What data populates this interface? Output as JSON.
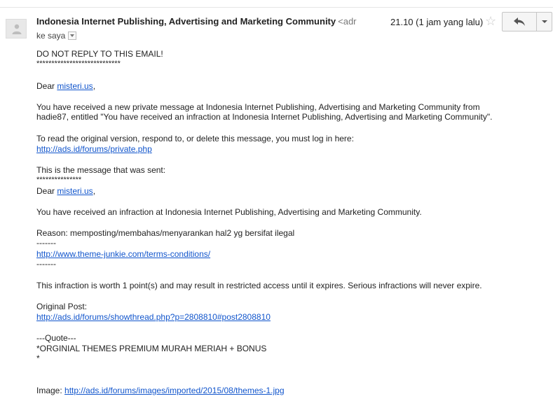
{
  "header": {
    "sender_name": "Indonesia Internet Publishing, Advertising and Marketing Community",
    "sender_email": "<adr",
    "recipient_label": "ke saya",
    "time": "21.10 (1 jam yang lalu)"
  },
  "icons": {
    "avatar": "person-icon",
    "star": "star-icon",
    "reply": "reply-arrow-icon",
    "more": "chevron-down-icon",
    "recipient_dropdown": "chevron-down-icon"
  },
  "colors": {
    "link": "#1155cc",
    "text": "#222222",
    "button_bg": "#f5f5f5"
  },
  "body": {
    "warning": "DO NOT REPLY TO THIS EMAIL!",
    "stars_long": "****************************",
    "dear1_prefix": "Dear ",
    "dear1_link": "misteri.us",
    "dear1_suffix": ",",
    "intro_line1": "You have received a new private message at Indonesia Internet Publishing, Advertising and Marketing Community from",
    "intro_line2": "hadie87, entitled \"You have received an infraction at Indonesia Internet Publishing, Advertising and Marketing Community\".",
    "read_line": "To read the original version, respond to, or delete this message, you must log in here:",
    "private_link": "http://ads.id/forums/private.php",
    "sent_line": "This is the message that was sent:",
    "stars_short": "***************",
    "dear2_prefix": "Dear ",
    "dear2_link": "misteri.us",
    "dear2_suffix": ",",
    "infraction_line": "You have received an infraction at Indonesia Internet Publishing, Advertising and Marketing Community.",
    "reason_line": "Reason: memposting/membahas/menyarankan hal2 yg bersifat ilegal",
    "dashes1": "-------",
    "terms_link": "http://www.theme-junkie.com/terms-conditions/",
    "dashes2": "-------",
    "worth_line": "This infraction is worth 1 point(s) and may result in restricted access until it expires.  Serious infractions will never expire.",
    "original_post_label": "Original Post:",
    "post_link": "http://ads.id/forums/showthread.php?p=2808810#post2808810",
    "quote_label": "---Quote---",
    "quote_text": "*ORGINIAL THEMES PREMIUM MURAH MERIAH + BONUS",
    "quote_star": "*",
    "image_label": "Image: ",
    "image_link": "http://ads.id/forums/images/imported/2015/08/themes-1.jpg"
  }
}
